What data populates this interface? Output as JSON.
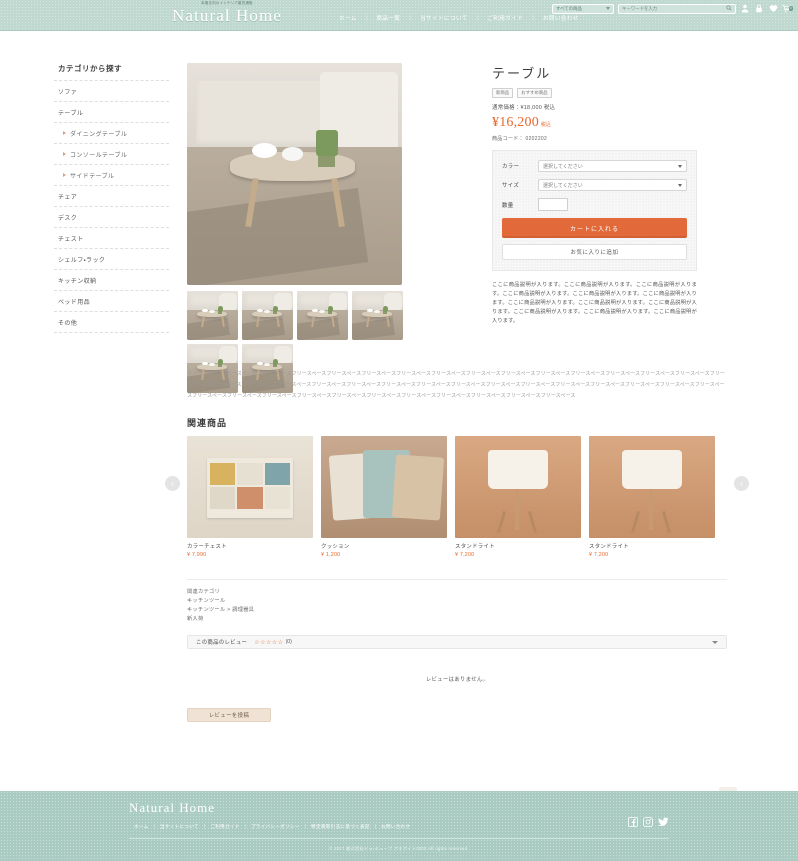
{
  "header": {
    "tagline": "本格志向のインテリア雑貨通販",
    "logo": "Natural Home",
    "nav": [
      "ホーム",
      "商品一覧",
      "当サイトについて",
      "ご利用ガイド",
      "お問い合わせ"
    ],
    "category_select": "すべての商品",
    "search_placeholder": "キーワードを入力",
    "cart_count": "0",
    "icons": [
      "user-icon",
      "lock-icon",
      "heart-icon",
      "cart-icon"
    ]
  },
  "sidebar": {
    "title": "カテゴリから探す",
    "items": [
      {
        "label": "ソファ",
        "child": false
      },
      {
        "label": "テーブル",
        "child": false
      },
      {
        "label": "ダイニングテーブル",
        "child": true
      },
      {
        "label": "コンソールテーブル",
        "child": true
      },
      {
        "label": "サイドテーブル",
        "child": true
      },
      {
        "label": "チェア",
        "child": false
      },
      {
        "label": "デスク",
        "child": false
      },
      {
        "label": "チェスト",
        "child": false
      },
      {
        "label": "シェルフ・ラック",
        "child": false
      },
      {
        "label": "キッチン収納",
        "child": false
      },
      {
        "label": "ベッド用品",
        "child": false
      },
      {
        "label": "その他",
        "child": false
      }
    ]
  },
  "product": {
    "title": "テーブル",
    "badges": [
      "新商品",
      "おすすめ商品"
    ],
    "regular_price": "通常価格：¥18,000 税込",
    "price": "¥16,200",
    "price_tax": "税込",
    "code": "商品コード： 0202202",
    "options": {
      "color_label": "カラー",
      "color_value": "選択してください",
      "size_label": "サイズ",
      "size_value": "選択してください",
      "qty_label": "数量",
      "qty_value": ""
    },
    "add_to_cart": "カートに入れる",
    "add_to_favorites": "お気に入りに追加",
    "description": "ここに商品説明が入ります。ここに商品説明が入ります。ここに商品説明が入ります。ここに商品説明が入ります。ここに商品説明が入ります。ここに商品説明が入ります。ここに商品説明が入ります。ここに商品説明が入ります。ここに商品説明が入ります。ここに商品説明が入ります。ここに商品説明が入ります。ここに商品説明が入ります。",
    "thumbnail_count": 6
  },
  "freetext": "フリースペースフリースペースフリースペースフリースペースフリースペースフリースペースフリースペースフリースペースフリースペースフリースペースフリースペースフリースペースフリースペースフリースペースフリースペースフリースペースフリースペースフリースペースフリースペースフリースペースフリースペースフリースペースフリースペースフリースペースフリースペースフリースペースフリースペースフリースペースフリースペースフリースペースフリースペースフリースペースフリースペースフリースペースフリースペースフリースペースフリースペースフリースペースフリースペースフリースペースフリースペースフリースペース",
  "related": {
    "title": "関連商品",
    "prev_label": "‹",
    "next_label": "›",
    "cards": [
      {
        "name": "カラーチェスト",
        "price": "¥ 7,990",
        "style": "chest"
      },
      {
        "name": "クッション",
        "price": "¥ 1,200",
        "style": "cushion"
      },
      {
        "name": "スタンドライト",
        "price": "¥ 7,200",
        "style": "lamp"
      },
      {
        "name": "スタンドライト",
        "price": "¥ 7,200",
        "style": "lamp"
      }
    ]
  },
  "tags": {
    "heading": "関連カテゴリ",
    "links": [
      "キッチンツール",
      "キッチンツール > 調理器具",
      "新入荷"
    ]
  },
  "review": {
    "bar_label": "この商品のレビュー",
    "stars": "☆☆☆☆☆",
    "count": "(0)",
    "empty_text": "レビューはありません。",
    "post_button": "レビューを投稿",
    "to_top": "▲"
  },
  "footer": {
    "logo": "Natural Home",
    "nav": [
      "ホーム",
      "当サイトについて",
      "ご利用ガイド",
      "プライバシーポリシー",
      "特定商取引法に基づく表記",
      "お問い合わせ"
    ],
    "social": [
      "facebook-icon",
      "instagram-icon",
      "twitter-icon"
    ],
    "copyright": "© 2017 株式会社ドゥ・キューブ アキアイト3000 All rights reserved."
  }
}
